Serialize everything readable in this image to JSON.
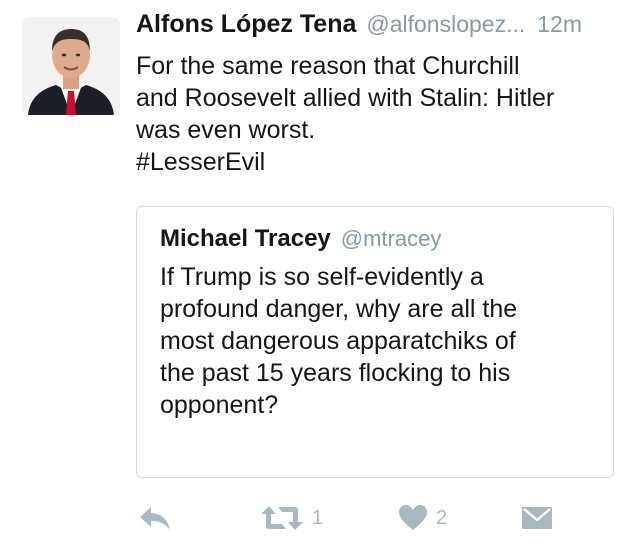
{
  "tweet": {
    "author_name": "Alfons López Tena",
    "author_handle": "@alfonslopez...",
    "time": "12m",
    "text_lines": [
      "For the same reason that Churchill",
      "and Roosevelt allied with Stalin: Hitler",
      "was even worst.",
      "#LesserEvil"
    ]
  },
  "quoted": {
    "author_name": "Michael Tracey",
    "author_handle": "@mtracey",
    "text_lines": [
      "If Trump is so self-evidently a",
      "profound danger, why are all the",
      "most dangerous apparatchiks of",
      "the past 15 years flocking to his",
      "opponent?"
    ]
  },
  "actions": {
    "reply_icon": "reply-icon",
    "retweet_icon": "retweet-icon",
    "retweet_count": "1",
    "like_icon": "heart-icon",
    "like_count": "2",
    "dm_icon": "envelope-icon"
  },
  "colors": {
    "text": "#14171a",
    "secondary": "#8899a6",
    "icon": "#aab8c2",
    "border": "#d5dbe0"
  }
}
